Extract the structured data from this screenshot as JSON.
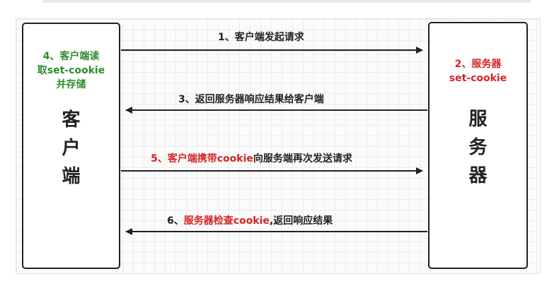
{
  "client": {
    "note_lines": [
      "4、客户端读",
      "取set-cookie",
      "并存储"
    ],
    "title_chars": [
      "客",
      "户",
      "端"
    ]
  },
  "server": {
    "note_lines": [
      "2、服务器",
      "set-cookie"
    ],
    "title_chars": [
      "服",
      "务",
      "器"
    ]
  },
  "arrows": [
    {
      "direction": "to-server",
      "parts": [
        {
          "text": "1、客户端发起请求",
          "color": "#222222"
        }
      ]
    },
    {
      "direction": "to-client",
      "parts": [
        {
          "text": "3、返回服务器响应结果给客户端",
          "color": "#222222"
        }
      ]
    },
    {
      "direction": "to-server",
      "parts": [
        {
          "text": "5、客户端携带cookie",
          "color": "#d42525"
        },
        {
          "text": "向服务端再次发送请求",
          "color": "#222222"
        }
      ]
    },
    {
      "direction": "to-client",
      "parts": [
        {
          "text": "6、",
          "color": "#222222"
        },
        {
          "text": "服务器检查cookie",
          "color": "#d42525"
        },
        {
          "text": ",返回响应结果",
          "color": "#222222"
        }
      ]
    }
  ],
  "colors": {
    "green_note": "#2e8b2e",
    "red_note": "#d42525",
    "line": "#222222"
  }
}
